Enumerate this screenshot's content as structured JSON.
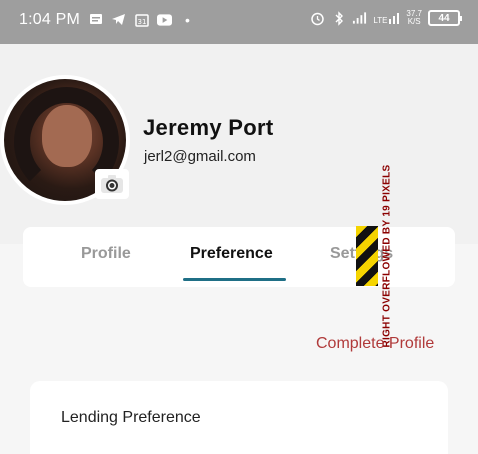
{
  "status_bar": {
    "time": "1:04 PM",
    "dot": "•",
    "lte_label": "LTE",
    "net_speed_value": "37.7",
    "net_speed_unit": "K/S",
    "battery": "44",
    "left_icons": [
      "message-icon",
      "telegram-icon",
      "calendar-icon",
      "youtube-icon",
      "dot-icon"
    ],
    "right_icons": [
      "alarm-icon",
      "bluetooth-icon",
      "signal-icon",
      "lte-signal-icon"
    ]
  },
  "profile": {
    "name": "Jeremy Port",
    "email": "jerl2@gmail.com"
  },
  "tabs": [
    {
      "label": "Profile"
    },
    {
      "label": "Preference"
    },
    {
      "label": "Settings"
    }
  ],
  "overflow_warning": "RIGHT OVERFLOWED BY 19 PIXELS",
  "complete_profile": "Complete Profile",
  "lending_card": {
    "title": "Lending Preference"
  },
  "colors": {
    "status_bar": "#9e9e9e",
    "tab_indicator": "#1f6f86",
    "link": "#b03a3a"
  }
}
